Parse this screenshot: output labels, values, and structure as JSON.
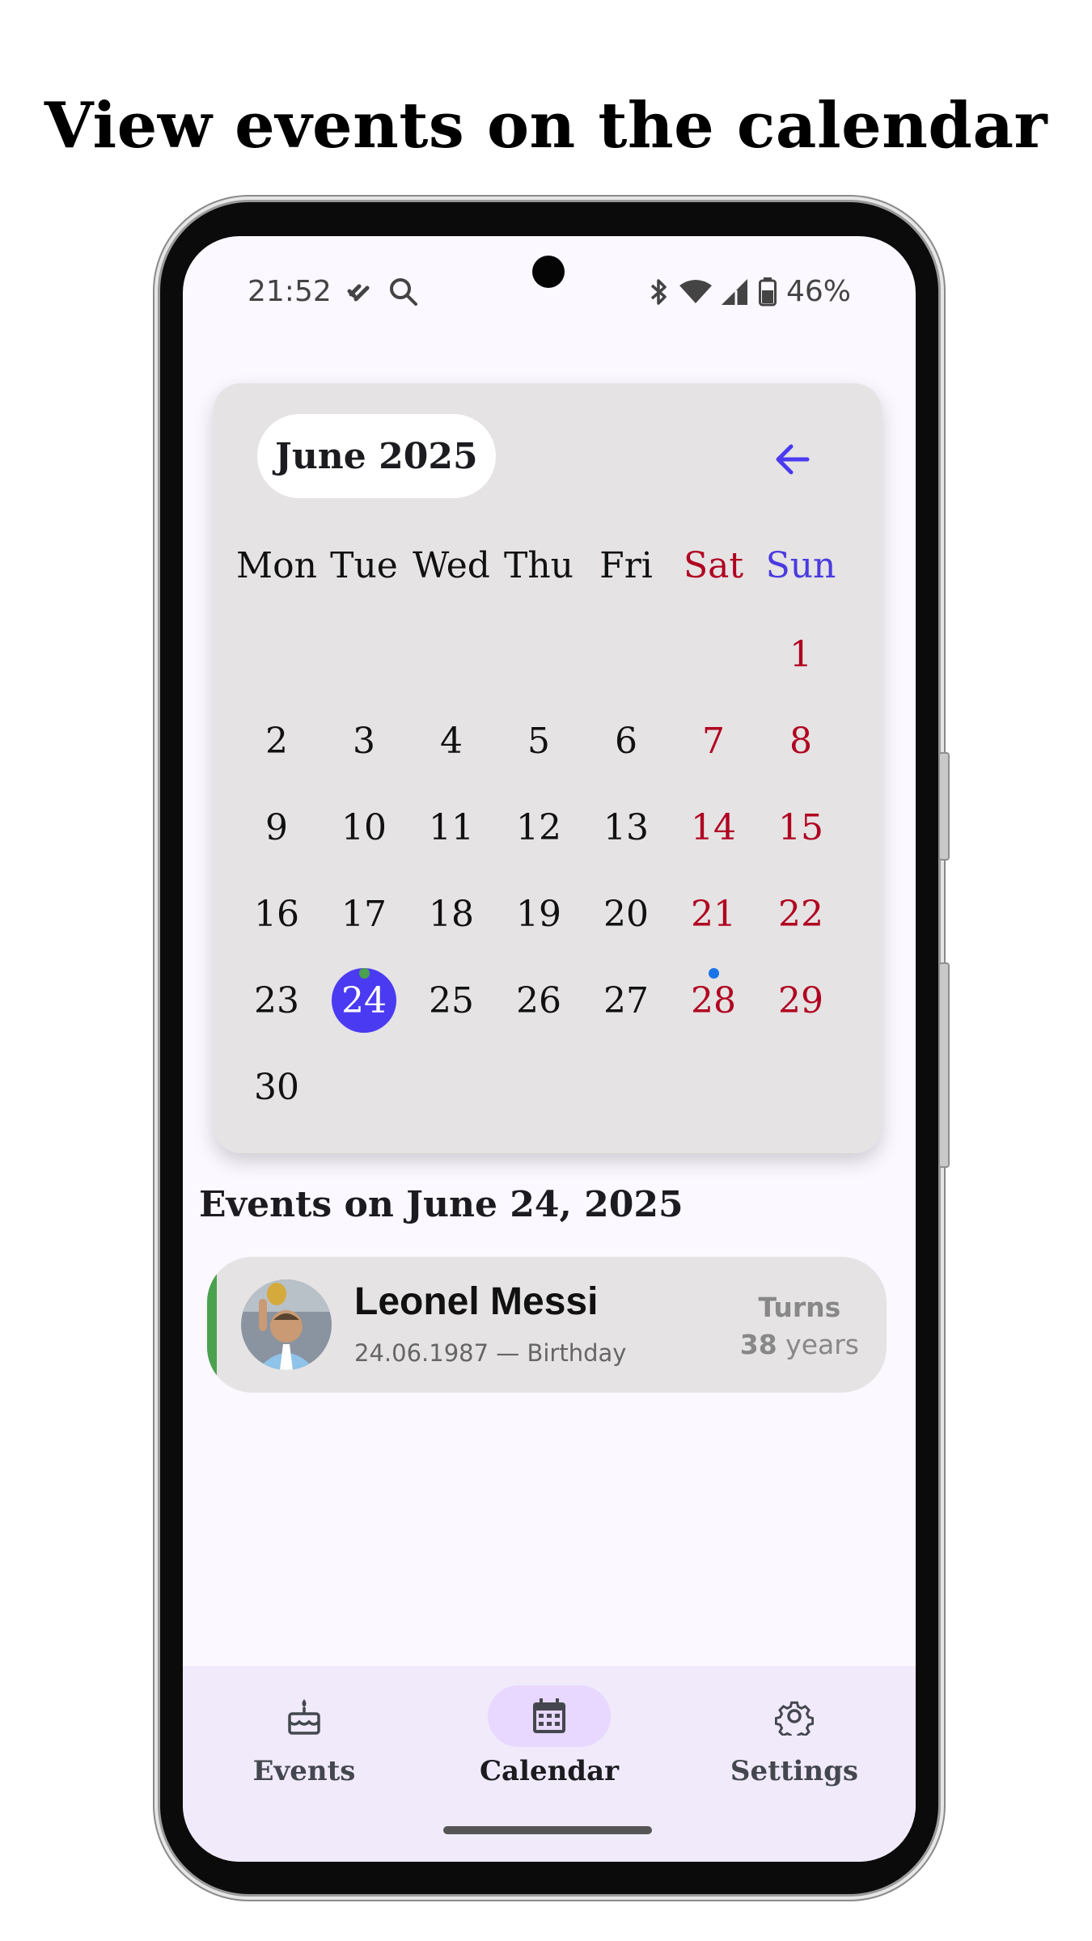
{
  "headline": "View events on the calendar",
  "status_bar": {
    "time": "21:52",
    "battery": "46%",
    "icons": [
      "signal-app-icon",
      "search-icon",
      "bluetooth-icon",
      "wifi-icon",
      "cell-signal-icon",
      "battery-icon"
    ]
  },
  "calendar": {
    "month_label": "June 2025",
    "back_icon": "arrow-left-icon",
    "weekdays": [
      "Mon",
      "Tue",
      "Wed",
      "Thu",
      "Fri",
      "Sat",
      "Sun"
    ],
    "weeks": [
      [
        "",
        "",
        "",
        "",
        "",
        "",
        "1"
      ],
      [
        "2",
        "3",
        "4",
        "5",
        "6",
        "7",
        "8"
      ],
      [
        "9",
        "10",
        "11",
        "12",
        "13",
        "14",
        "15"
      ],
      [
        "16",
        "17",
        "18",
        "19",
        "20",
        "21",
        "22"
      ],
      [
        "23",
        "24",
        "25",
        "26",
        "27",
        "28",
        "29"
      ],
      [
        "30",
        "",
        "",
        "",
        "",
        "",
        ""
      ]
    ],
    "selected_day": "24",
    "event_dots": [
      {
        "day": "24",
        "color": "#4aa14e"
      },
      {
        "day": "28",
        "color": "#1a73e8"
      }
    ],
    "colors": {
      "weekend": "#b00020",
      "sunday_header": "#4a3ae0",
      "selected": "#4a3af2"
    }
  },
  "events_section": {
    "title": "Events on June 24, 2025",
    "events": [
      {
        "name": "Leonel Messi",
        "subtitle": "24.06.1987 — Birthday",
        "turns_label": "Turns",
        "age": "38",
        "age_unit": "years",
        "accent_color": "#4aa14e"
      }
    ]
  },
  "bottom_nav": {
    "items": [
      {
        "label": "Events",
        "icon": "birthday-cake-icon",
        "active": false
      },
      {
        "label": "Calendar",
        "icon": "calendar-icon",
        "active": true
      },
      {
        "label": "Settings",
        "icon": "gear-icon",
        "active": false
      }
    ]
  }
}
